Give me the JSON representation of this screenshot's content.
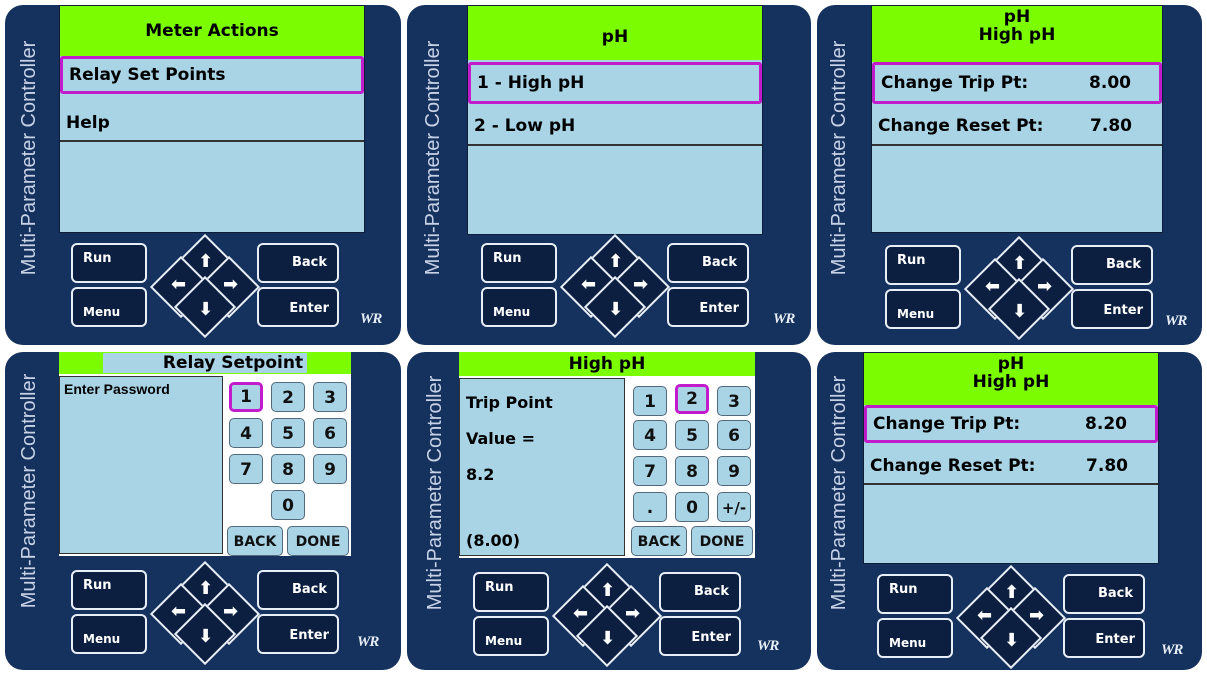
{
  "side_label": "Multi-Parameter Controller",
  "logo": "WR",
  "buttons": {
    "run": "Run",
    "menu": "Menu",
    "back": "Back",
    "enter": "Enter"
  },
  "panel1": {
    "header": "Meter Actions",
    "rows": [
      "Relay Set Points",
      "Help"
    ]
  },
  "panel2": {
    "header": "pH",
    "rows": [
      "1 - High pH",
      "2 - Low pH"
    ]
  },
  "panel3": {
    "header_line1": "pH",
    "header_line2": "High pH",
    "rows": [
      {
        "label": "Change Trip Pt:",
        "value": "8.00"
      },
      {
        "label": "Change Reset Pt:",
        "value": "7.80"
      }
    ]
  },
  "panel4": {
    "header": "Relay Setpoint",
    "prompt": "Enter Password",
    "keys": [
      "1",
      "2",
      "3",
      "4",
      "5",
      "6",
      "7",
      "8",
      "9",
      "0"
    ],
    "back": "BACK",
    "done": "DONE"
  },
  "panel5": {
    "header": "High pH",
    "line1": "Trip Point",
    "line2": "Value =",
    "line3": "8.2",
    "line4": "(8.00)",
    "keys": [
      "1",
      "2",
      "3",
      "4",
      "5",
      "6",
      "7",
      "8",
      "9",
      ".",
      "0",
      "+/-"
    ],
    "back": "BACK",
    "done": "DONE"
  },
  "panel6": {
    "header_line1": "pH",
    "header_line2": "High pH",
    "rows": [
      {
        "label": "Change Trip Pt:",
        "value": "8.20"
      },
      {
        "label": "Change Reset Pt:",
        "value": "7.80"
      }
    ]
  }
}
